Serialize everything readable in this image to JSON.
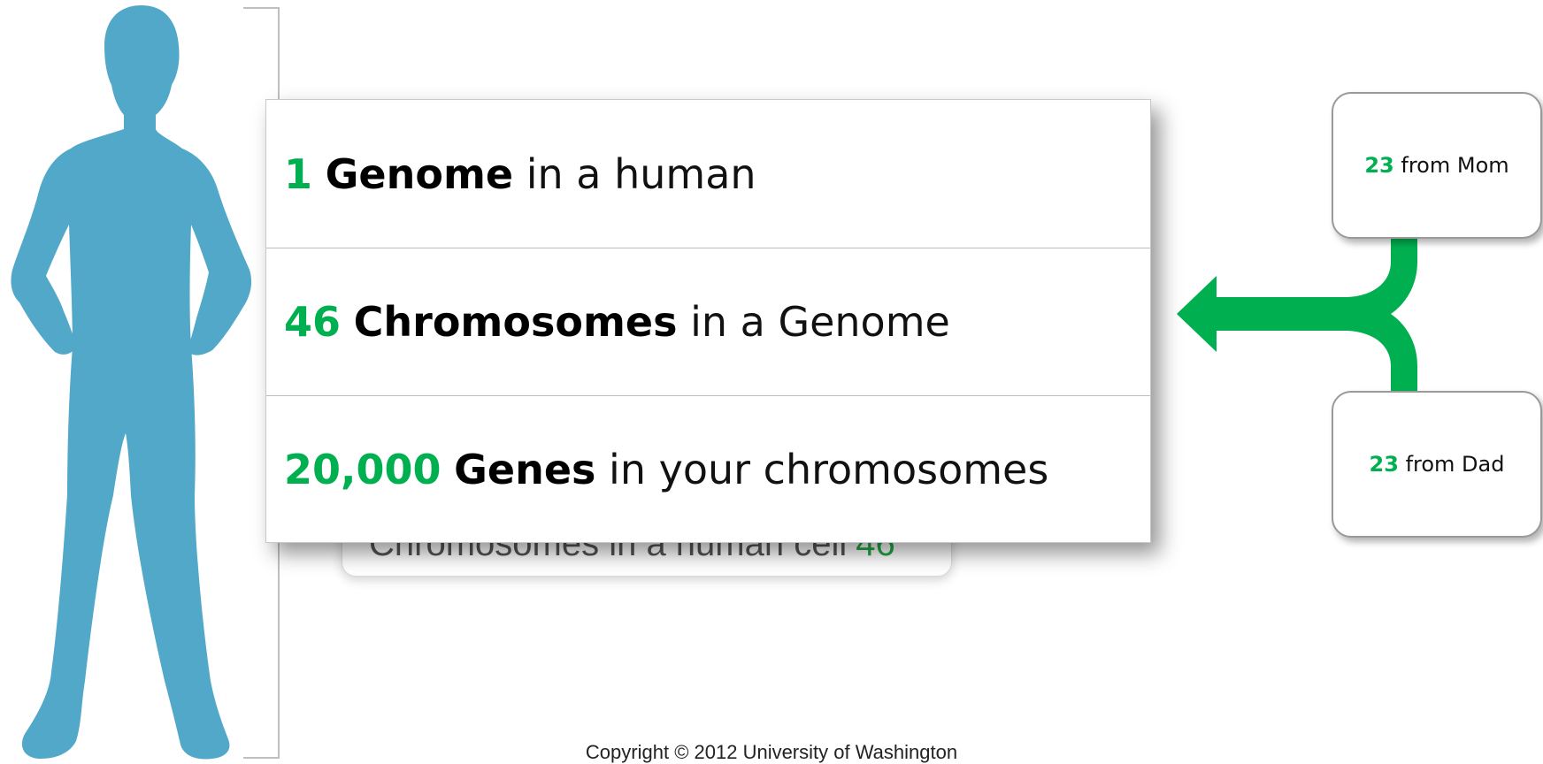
{
  "facts": [
    {
      "number": "1",
      "term": "Genome",
      "rest": "in a human"
    },
    {
      "number": "46",
      "term": "Chromosomes",
      "rest": "in a Genome"
    },
    {
      "number": "20,000",
      "term": "Genes",
      "rest": "in your chromosomes"
    }
  ],
  "background_card": {
    "text": "Chromosomes in a human cell",
    "number": "46"
  },
  "parents": {
    "mom": {
      "number": "23",
      "text": "from Mom"
    },
    "dad": {
      "number": "23",
      "text": "from Dad"
    }
  },
  "footer": {
    "copyright": "Copyright © 2012 University of Washington"
  },
  "icons": {
    "human": "human-silhouette-icon",
    "arrow": "merge-arrow-icon",
    "bracket": "scale-bracket"
  },
  "colors": {
    "accent_green": "#00b050",
    "silhouette_blue": "#52a8c8",
    "bracket_gray": "#bfbfbf"
  }
}
